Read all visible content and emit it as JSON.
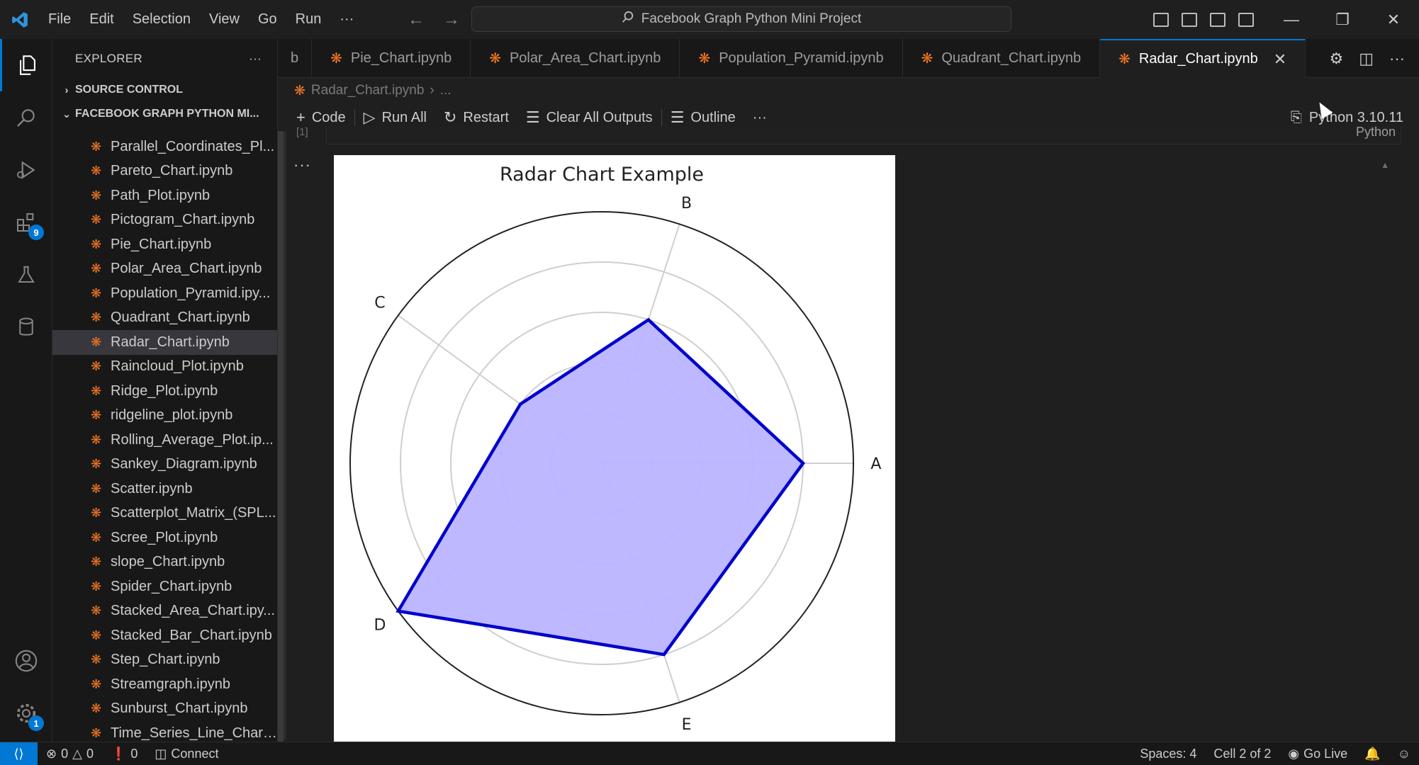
{
  "window": {
    "command_center": "Facebook Graph Python Mini Project"
  },
  "menu": [
    "File",
    "Edit",
    "Selection",
    "View",
    "Go",
    "Run",
    "···"
  ],
  "activity_bar": {
    "extensions_badge": "9",
    "settings_badge": "1"
  },
  "sidebar": {
    "header": "EXPLORER",
    "more": "···",
    "source_control": "SOURCE CONTROL",
    "folder": "FACEBOOK GRAPH PYTHON MI...",
    "files": [
      "Parallel_Coordinates_Pl...",
      "Pareto_Chart.ipynb",
      "Path_Plot.ipynb",
      "Pictogram_Chart.ipynb",
      "Pie_Chart.ipynb",
      "Polar_Area_Chart.ipynb",
      "Population_Pyramid.ipy...",
      "Quadrant_Chart.ipynb",
      "Radar_Chart.ipynb",
      "Raincloud_Plot.ipynb",
      "Ridge_Plot.ipynb",
      "ridgeline_plot.ipynb",
      "Rolling_Average_Plot.ip...",
      "Sankey_Diagram.ipynb",
      "Scatter.ipynb",
      "Scatterplot_Matrix_(SPL...",
      "Scree_Plot.ipynb",
      "slope_Chart.ipynb",
      "Spider_Chart.ipynb",
      "Stacked_Area_Chart.ipy...",
      "Stacked_Bar_Chart.ipynb",
      "Step_Chart.ipynb",
      "Streamgraph.ipynb",
      "Sunburst_Chart.ipynb",
      "Time_Series_Line_Chart...."
    ],
    "selected_index": 8
  },
  "tabs": {
    "partial": "b",
    "items": [
      "Pie_Chart.ipynb",
      "Polar_Area_Chart.ipynb",
      "Population_Pyramid.ipynb",
      "Quadrant_Chart.ipynb",
      "Radar_Chart.ipynb"
    ],
    "active_index": 4,
    "close": "✕"
  },
  "breadcrumb": {
    "file": "Radar_Chart.ipynb",
    "sep": "›",
    "rest": "..."
  },
  "toolbar": {
    "code": "Code",
    "run_all": "Run All",
    "restart": "Restart",
    "clear_outputs": "Clear All Outputs",
    "outline": "Outline",
    "more": "···",
    "kernel": "Python 3.10.11"
  },
  "cell": {
    "execution_count": "[1]",
    "language": "Python",
    "output_more": "···"
  },
  "status_bar": {
    "errors": "0",
    "warnings": "0",
    "ports": "0",
    "connect": "Connect",
    "spaces": "Spaces: 4",
    "cell_pos": "Cell 2 of 2",
    "go_live": "Go Live"
  },
  "chart_data": {
    "type": "radar",
    "title": "Radar Chart Example",
    "categories": [
      "A",
      "B",
      "C",
      "D",
      "E"
    ],
    "series": [
      {
        "values": [
          4,
          3,
          2,
          5,
          4
        ]
      }
    ],
    "rlim": [
      0,
      5
    ],
    "rgrid": [
      1,
      2,
      3,
      4
    ],
    "fill_color": "#b9b4ff",
    "line_color": "#0000cc"
  }
}
